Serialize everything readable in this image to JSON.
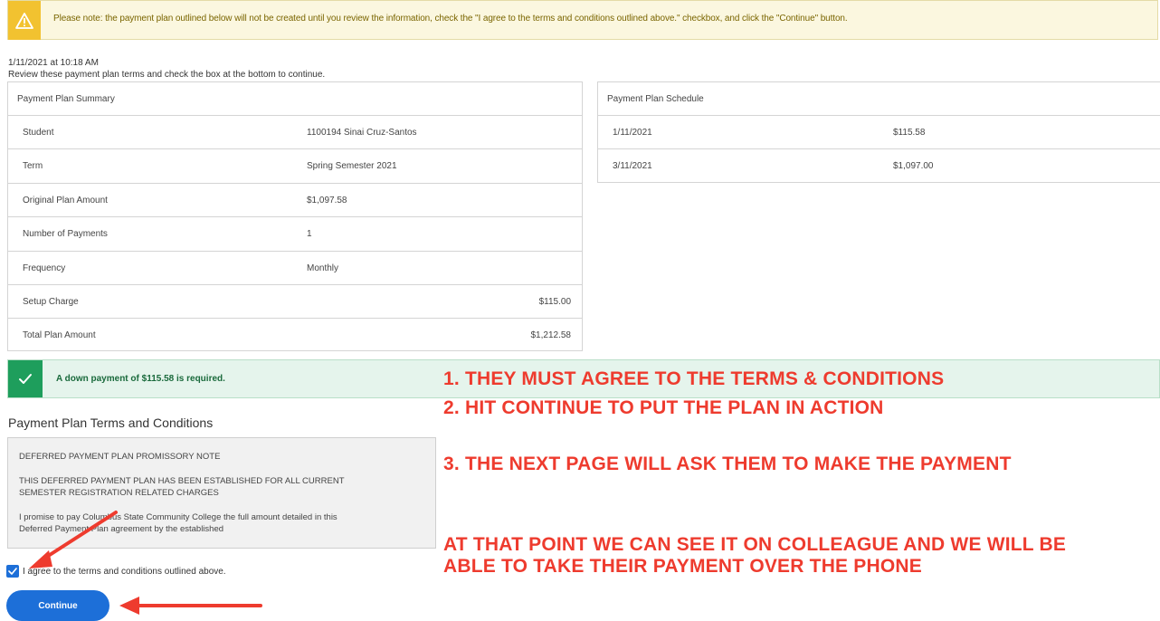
{
  "notice": {
    "text": "Please note: the payment plan outlined below will not be created until you review the information, check the \"I agree to the terms and conditions outlined above.\" checkbox, and click the \"Continue\" button.",
    "icon": "warning-icon",
    "bg": "#fbf7df",
    "accent": "#f2c230"
  },
  "timestamp": "1/11/2021 at 10:18 AM",
  "instructions": "Review these payment plan terms and check the box at the bottom to continue.",
  "summary": {
    "title": "Payment Plan Summary",
    "rows": [
      {
        "label": "Student",
        "value": "1100194 Sinai Cruz-Santos"
      },
      {
        "label": "Term",
        "value": "Spring Semester 2021"
      },
      {
        "label": "Original Plan Amount",
        "value": "$1,097.58"
      },
      {
        "label": "Number of Payments",
        "value": "1"
      },
      {
        "label": "Frequency",
        "value": "Monthly"
      },
      {
        "label": "Setup Charge",
        "value": "$115.00"
      },
      {
        "label": "Total Plan Amount",
        "value": "$1,212.58"
      }
    ]
  },
  "schedule": {
    "title": "Payment Plan Schedule",
    "rows": [
      {
        "date": "1/11/2021",
        "amount": "$115.58"
      },
      {
        "date": "3/11/2021",
        "amount": "$1,097.00"
      }
    ]
  },
  "success": {
    "text": "A down payment of $115.58 is required.",
    "icon": "check-icon",
    "accent": "#1e9e5c"
  },
  "terms": {
    "title": "Payment Plan Terms and Conditions",
    "p1": "DEFERRED PAYMENT PLAN PROMISSORY NOTE",
    "p2": "THIS DEFERRED PAYMENT PLAN HAS BEEN ESTABLISHED FOR ALL CURRENT SEMESTER REGISTRATION RELATED CHARGES",
    "p3": "I promise to pay Columbus State Community College the full amount detailed in this Deferred Payment Plan agreement by the established"
  },
  "agree": {
    "label": "I agree to the terms and conditions outlined above.",
    "checked": true
  },
  "continue_label": "Continue",
  "annotations": {
    "line1": "1. THEY MUST AGREE TO THE TERMS & CONDITIONS",
    "line2": "2. HIT CONTINUE TO PUT THE PLAN IN ACTION",
    "line3": "3. THE NEXT PAGE WILL ASK THEM TO MAKE THE PAYMENT",
    "line4": "AT THAT POINT WE CAN SEE IT ON COLLEAGUE AND WE WILL BE ABLE TO TAKE THEIR PAYMENT OVER THE PHONE",
    "color": "#ee3b2e"
  }
}
